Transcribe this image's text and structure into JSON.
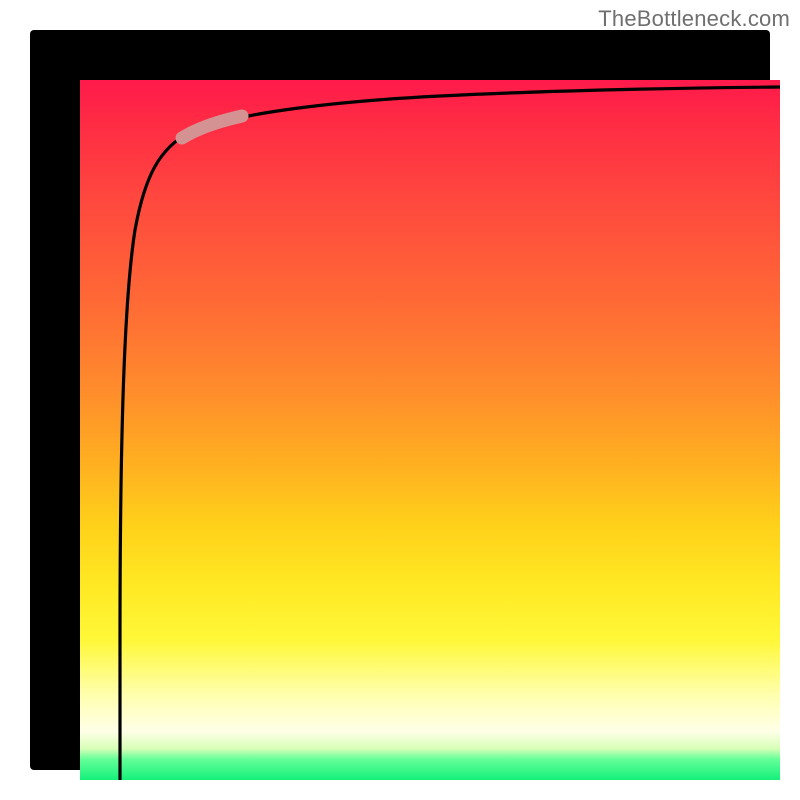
{
  "watermark": "TheBottleneck.com",
  "chart_data": {
    "type": "line",
    "title": "",
    "xlabel": "",
    "ylabel": "",
    "xlim": [
      0,
      100
    ],
    "ylim": [
      0,
      100
    ],
    "series": [
      {
        "name": "curve",
        "x": [
          5.7,
          5.8,
          6.0,
          6.2,
          6.5,
          7.0,
          7.5,
          8.0,
          9.0,
          10,
          12,
          14,
          17,
          20,
          25,
          30,
          40,
          50,
          60,
          75,
          90,
          100
        ],
        "y": [
          0,
          20,
          40,
          55,
          65,
          74,
          79,
          82,
          86,
          88,
          90.5,
          92,
          93,
          94,
          94.8,
          95.4,
          96.1,
          96.6,
          97.0,
          97.4,
          97.7,
          97.9
        ]
      }
    ],
    "highlight": {
      "x_range": [
        14,
        21
      ],
      "note": "pink segment marker"
    },
    "gradient_stops": [
      {
        "pos": 0,
        "color": "#ff1a4b"
      },
      {
        "pos": 0.45,
        "color": "#ff8b2c"
      },
      {
        "pos": 0.72,
        "color": "#ffe823"
      },
      {
        "pos": 0.93,
        "color": "#ffffe8"
      },
      {
        "pos": 1.0,
        "color": "#14f07a"
      }
    ]
  }
}
